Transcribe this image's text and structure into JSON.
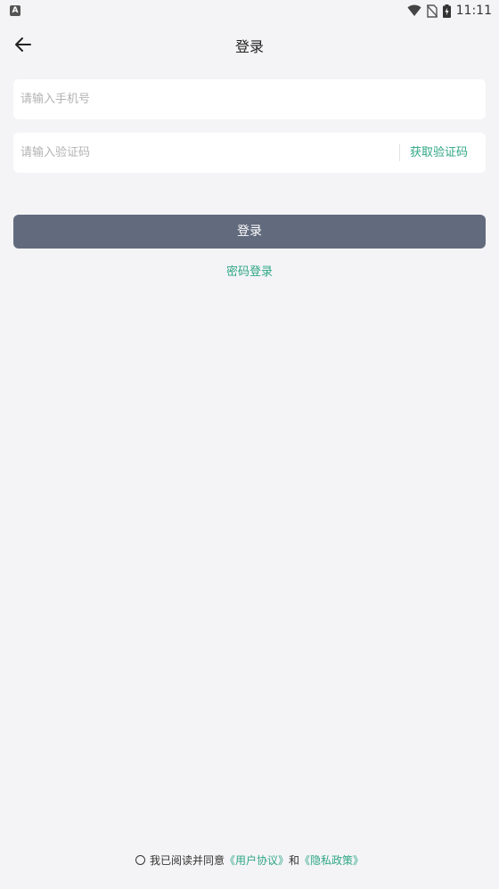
{
  "status_bar": {
    "notification_icon": "A",
    "time": "11:11",
    "icons": [
      "wifi-icon",
      "no-sim-icon",
      "battery-charging-icon"
    ]
  },
  "header": {
    "title": "登录",
    "back_icon": "arrow-left-icon"
  },
  "form": {
    "phone_placeholder": "请输入手机号",
    "code_placeholder": "请输入验证码",
    "get_code_label": "获取验证码",
    "login_label": "登录",
    "password_login_label": "密码登录"
  },
  "agreement": {
    "prefix": "我已阅读并同意",
    "user_agreement": "《用户协议》",
    "conjunction": "和",
    "privacy_policy": "《隐私政策》"
  },
  "colors": {
    "background": "#f4f4f6",
    "accent": "#2fa784",
    "button": "#626a7e",
    "field": "#ffffff"
  }
}
